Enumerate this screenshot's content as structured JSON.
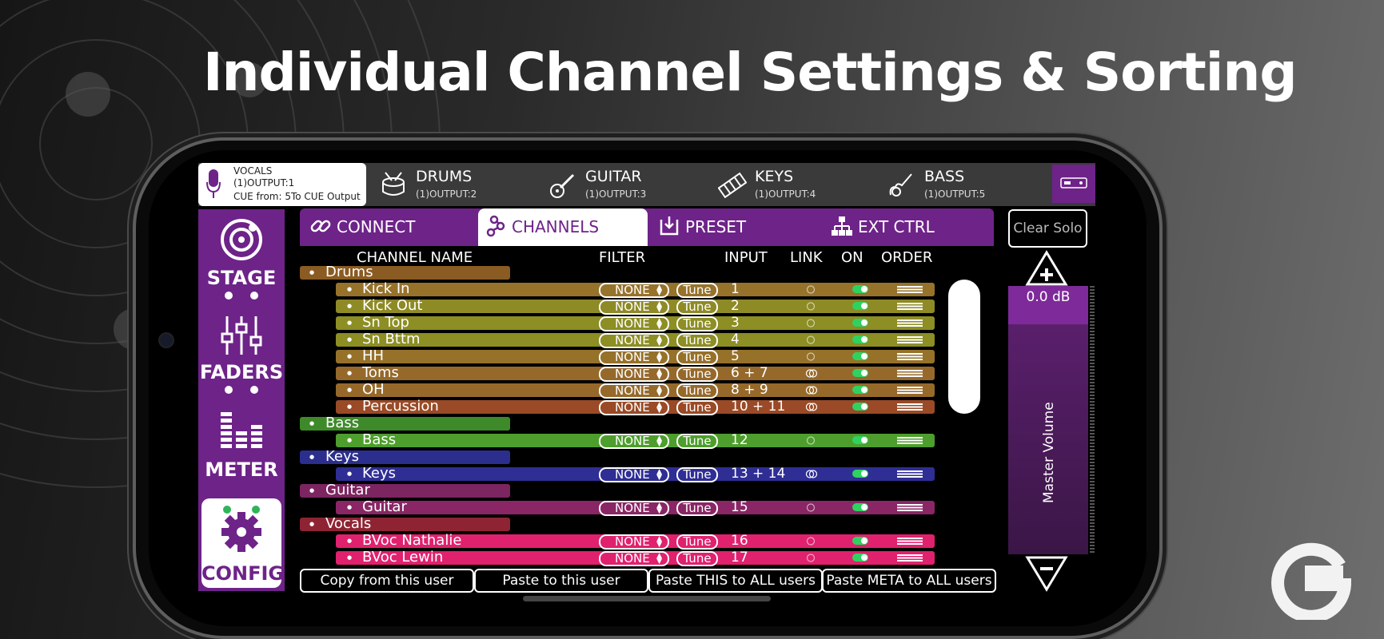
{
  "headline": "Individual Channel Settings & Sorting",
  "users": [
    {
      "name": "VOCALS",
      "output": "(1)OUTPUT:1",
      "cue": "CUE from: 5To CUE Output",
      "icon": "microphone-icon"
    },
    {
      "name": "DRUMS",
      "output": "(1)OUTPUT:2",
      "icon": "drum-icon"
    },
    {
      "name": "GUITAR",
      "output": "(1)OUTPUT:3",
      "icon": "guitar-icon"
    },
    {
      "name": "KEYS",
      "output": "(1)OUTPUT:4",
      "icon": "keyboard-icon"
    },
    {
      "name": "BASS",
      "output": "(1)OUTPUT:5",
      "icon": "bass-icon"
    }
  ],
  "nav": [
    {
      "label": "STAGE",
      "icon": "stage-icon"
    },
    {
      "label": "FADERS",
      "icon": "faders-icon"
    },
    {
      "label": "METER",
      "icon": "meter-icon"
    },
    {
      "label": "CONFIG",
      "icon": "gear-icon"
    }
  ],
  "tabs": [
    "CONNECT",
    "CHANNELS",
    "PRESET",
    "EXT CTRL"
  ],
  "clear_solo": "Clear Solo",
  "columns": {
    "name": "CHANNEL NAME",
    "filter": "FILTER",
    "input": "INPUT",
    "link": "LINK",
    "on": "ON",
    "order": "ORDER"
  },
  "filter_value": "NONE",
  "tune_label": "Tune",
  "rows": [
    {
      "type": "group",
      "name": "Drums",
      "color": "#8a5b22"
    },
    {
      "type": "channel",
      "name": "Kick In",
      "input": "1",
      "linked": false,
      "color": "#97722a"
    },
    {
      "type": "channel",
      "name": "Kick Out",
      "input": "2",
      "linked": false,
      "color": "#8e8a26"
    },
    {
      "type": "channel",
      "name": "Sn Top",
      "input": "3",
      "linked": false,
      "color": "#8d8e23"
    },
    {
      "type": "channel",
      "name": "Sn Bttm",
      "input": "4",
      "linked": false,
      "color": "#8d8e23"
    },
    {
      "type": "channel",
      "name": "HH",
      "input": "5",
      "linked": false,
      "color": "#96712a"
    },
    {
      "type": "channel",
      "name": "Toms",
      "input": "6 + 7",
      "linked": true,
      "color": "#96692b"
    },
    {
      "type": "channel",
      "name": "OH",
      "input": "8 + 9",
      "linked": true,
      "color": "#96692b"
    },
    {
      "type": "channel",
      "name": "Percussion",
      "input": "10 + 11",
      "linked": true,
      "color": "#9a4a26"
    },
    {
      "type": "group",
      "name": "Bass",
      "color": "#3e8a2a"
    },
    {
      "type": "channel",
      "name": "Bass",
      "input": "12",
      "linked": false,
      "color": "#4e9e2d"
    },
    {
      "type": "group",
      "name": "Keys",
      "color": "#2c2e8e"
    },
    {
      "type": "channel",
      "name": "Keys",
      "input": "13 + 14",
      "linked": true,
      "color": "#2f2e95"
    },
    {
      "type": "group",
      "name": "Guitar",
      "color": "#7c2561"
    },
    {
      "type": "channel",
      "name": "Guitar",
      "input": "15",
      "linked": false,
      "color": "#8a2665"
    },
    {
      "type": "group",
      "name": "Vocals",
      "color": "#8e2433"
    },
    {
      "type": "channel",
      "name": "BVoc Nathalie",
      "input": "16",
      "linked": false,
      "color": "#e0216e"
    },
    {
      "type": "channel",
      "name": "BVoc Lewin",
      "input": "17",
      "linked": false,
      "color": "#e0216e"
    }
  ],
  "bottom_buttons": [
    "Copy from this user",
    "Paste to this user",
    "Paste THIS to ALL users",
    "Paste META to ALL users"
  ],
  "master": {
    "value": "0.0 dB",
    "label": "Master Volume",
    "level_fraction": 0.0
  }
}
